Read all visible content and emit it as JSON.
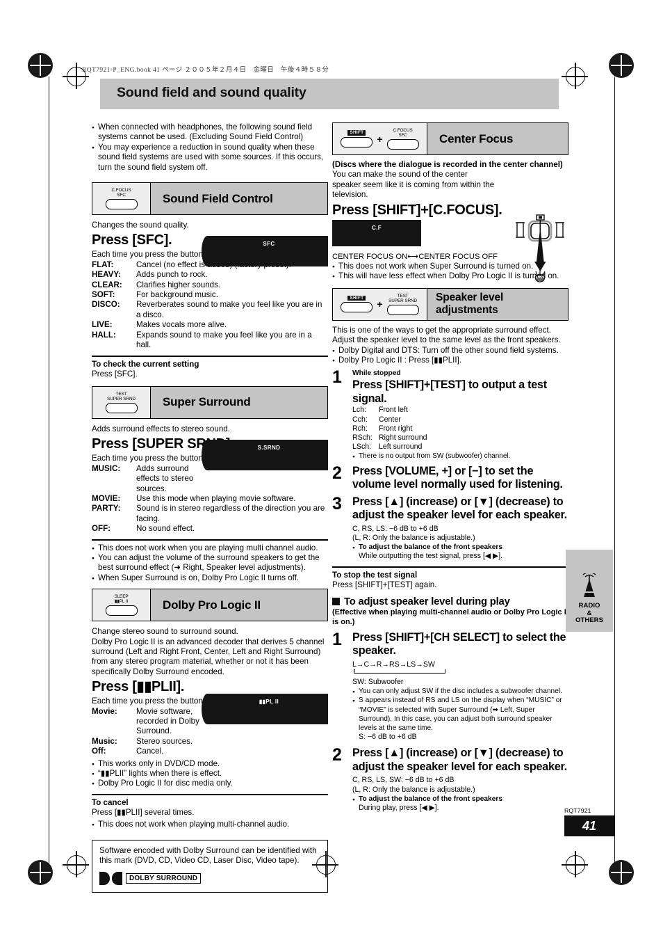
{
  "header": {
    "book_line": "RQT7921-P_ENG.book  41 ページ  ２００５年２月４日　金曜日　午後４時５８分",
    "title": "Sound field and sound quality"
  },
  "left_column": {
    "intro_bullets": [
      "When connected with headphones, the following sound field systems cannot be used. (Excluding Sound Field Control)",
      "You may experience a reduction in sound quality when these sound field systems are used with some sources. If this occurs, turn the sound field system off."
    ],
    "sound_field_control": {
      "key_top": "C.FOCUS",
      "key_bottom": "SFC",
      "heading": "Sound Field Control",
      "intro": "Changes the sound quality.",
      "press": "Press [SFC].",
      "display_text": "SFC",
      "each_time": "Each time you press the button:",
      "modes": [
        {
          "name": "FLAT:",
          "desc": "Cancel (no effect is added) (factory preset)."
        },
        {
          "name": "HEAVY:",
          "desc": "Adds punch to rock."
        },
        {
          "name": "CLEAR:",
          "desc": "Clarifies higher sounds."
        },
        {
          "name": "SOFT:",
          "desc": "For background music."
        },
        {
          "name": "DISCO:",
          "desc": "Reverberates sound to make you feel like you are in a disco."
        },
        {
          "name": "LIVE:",
          "desc": "Makes vocals more alive."
        },
        {
          "name": "HALL:",
          "desc": "Expands sound to make you feel like you are in a hall."
        }
      ],
      "check_heading": "To check the current setting",
      "check_text": "Press [SFC]."
    },
    "super_surround": {
      "key_top": "TEST",
      "key_bottom": "SUPER SRND",
      "heading": "Super Surround",
      "intro": "Adds surround effects to stereo sound.",
      "press": "Press [SUPER SRND].",
      "display_text": "S.SRND",
      "each_time": "Each time you press the button:",
      "modes": [
        {
          "name": "MUSIC:",
          "desc": "Adds surround effects to stereo sources."
        },
        {
          "name": "MOVIE:",
          "desc": "Use this mode when playing movie software."
        },
        {
          "name": "PARTY:",
          "desc": "Sound is in stereo regardless of the direction you are facing."
        },
        {
          "name": "OFF:",
          "desc": "No sound effect."
        }
      ],
      "notes": [
        "This does not work when you are playing multi channel audio.",
        "You can adjust the volume of the surround speakers to get the best surround effect (➜ Right, Speaker level adjustments).",
        "When Super Surround is on, Dolby Pro Logic II turns off."
      ]
    },
    "dolby_pro_logic": {
      "key_top": "SLEEP",
      "key_bottom": "▮▮PL II",
      "heading": "Dolby Pro Logic II",
      "intro1": "Change stereo sound to surround sound.",
      "intro2": "Dolby Pro Logic II is an advanced decoder that derives 5 channel surround (Left and Right Front, Center, Left and Right Surround) from any stereo program material, whether or not it has been specifically Dolby Surround encoded.",
      "press": "Press [▮▮PLII].",
      "display_text": "▮▮PL II",
      "each_time": "Each time you press the button:",
      "modes": [
        {
          "name": "Movie:",
          "desc": "Movie software, recorded in Dolby Surround."
        },
        {
          "name": "Music:",
          "desc": "Stereo sources."
        },
        {
          "name": "Off:",
          "desc": "Cancel."
        }
      ],
      "notes": [
        "This works only in DVD/CD mode.",
        "“▮▮PLII” lights when there is effect.",
        "Dolby Pro Logic II for disc media only."
      ],
      "cancel_heading": "To cancel",
      "cancel_text": "Press [▮▮PLII] several times.",
      "cancel_note": "This does not work when playing multi-channel audio."
    },
    "dolby_note_box": {
      "text": "Software encoded with Dolby Surround can be identified with this mark (DVD, CD, Video CD, Laser Disc, Video tape).",
      "logo_text": "DOLBY SURROUND"
    }
  },
  "right_column": {
    "center_focus": {
      "key1": "SHIFT",
      "key2_top": "C.FOCUS",
      "key2_bottom": "SFC",
      "plus": "+",
      "heading": "Center Focus",
      "subtitle": "(Discs where the dialogue is recorded in the center channel)",
      "body": "You can make the sound of the center speaker seem like it is coming from within the television.",
      "press": "Press [SHIFT]+[C.FOCUS].",
      "display_text": "C.F",
      "toggle": "CENTER FOCUS ON⟷CENTER FOCUS OFF",
      "notes": [
        "This does not work when Super Surround is turned on.",
        "This will have less effect when Dolby Pro Logic II is turned on."
      ]
    },
    "speaker_level": {
      "key1": "SHIFT",
      "key2_top": "TEST",
      "key2_bottom": "SUPER SRND",
      "plus": "+",
      "heading": "Speaker level adjustments",
      "intro": "This is one of the ways to get the appropriate surround effect. Adjust the speaker level to the same level as the front speakers.",
      "notes": [
        "Dolby Digital and DTS: Turn off the other sound field systems.",
        "Dolby Pro Logic II : Press [▮▮PLII]."
      ],
      "steps": [
        {
          "num": "1",
          "small": "While stopped",
          "big": "Press [SHIFT]+[TEST] to output a test signal.",
          "channels": [
            {
              "abbr": "Lch:",
              "name": "Front left"
            },
            {
              "abbr": "Cch:",
              "name": "Center"
            },
            {
              "abbr": "Rch:",
              "name": "Front right"
            },
            {
              "abbr": "RSch:",
              "name": "Right surround"
            },
            {
              "abbr": "LSch:",
              "name": "Left surround"
            }
          ],
          "note": "There is no output from SW (subwoofer) channel."
        },
        {
          "num": "2",
          "small": "",
          "big": "Press [VOLUME, +] or [−] to set the volume level normally used for listening."
        },
        {
          "num": "3",
          "small": "",
          "big": "Press [▲] (increase) or [▼] (decrease) to adjust the speaker level for each speaker.",
          "range": "C, RS, LS:  −6 dB to +6 dB",
          "range2": "(L, R:  Only the balance is adjustable.)",
          "balance_heading": "To adjust the balance of the front speakers",
          "balance_text": "While outputting the test signal, press [◀ ▶]."
        }
      ],
      "stop_heading": "To stop the test signal",
      "stop_text": "Press [SHIFT]+[TEST] again."
    },
    "during_play": {
      "heading": "To adjust speaker level during play",
      "subtitle": "(Effective when playing multi-channel audio or Dolby Pro Logic II is on.)",
      "steps": [
        {
          "num": "1",
          "big": "Press [SHIFT]+[CH SELECT] to select the speaker.",
          "sequence": "L→C→R→RS→LS→SW",
          "sw_label": "SW:  Subwoofer",
          "notes": [
            "You can only adjust SW if the disc includes a subwoofer channel.",
            "S appears instead of RS and LS on the display when “MUSIC” or “MOVIE” is selected with Super Surround (➡ Left, Super Surround). In this case, you can adjust both surround speaker levels at the same time.",
            "S: −6 dB to +6 dB"
          ]
        },
        {
          "num": "2",
          "big": "Press [▲] (increase) or [▼] (decrease) to adjust the speaker level for each speaker.",
          "range": "C, RS, LS, SW:  −6 dB to +6 dB",
          "range2": "(L, R:  Only the balance is adjustable.)",
          "balance_heading": "To adjust the balance of the front speakers",
          "balance_text": "During play, press [◀ ▶]."
        }
      ]
    }
  },
  "side_tab": {
    "line1": "RADIO",
    "line2": "&",
    "line3": "OTHERS"
  },
  "footer": {
    "model": "RQT7921",
    "page": "41"
  }
}
